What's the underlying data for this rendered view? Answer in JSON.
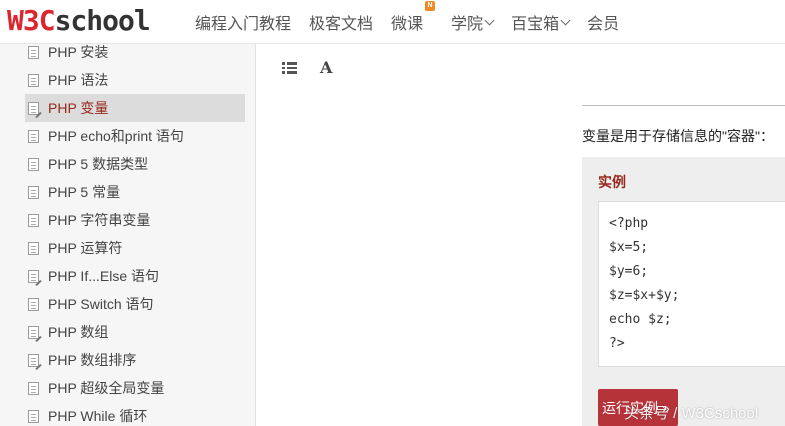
{
  "logo": {
    "prefix": "W3C",
    "suffix": "school"
  },
  "nav": {
    "items": [
      {
        "label": "编程入门教程"
      },
      {
        "label": "极客文档"
      },
      {
        "label": "微课",
        "badge": "N"
      },
      {
        "label": "学院"
      },
      {
        "label": "百宝箱"
      },
      {
        "label": "会员"
      }
    ]
  },
  "sidebar": {
    "items": [
      {
        "label": "PHP 安装"
      },
      {
        "label": "PHP 语法"
      },
      {
        "label": "PHP 变量"
      },
      {
        "label": "PHP echo和print 语句"
      },
      {
        "label": "PHP 5 数据类型"
      },
      {
        "label": "PHP 5 常量"
      },
      {
        "label": "PHP 字符串变量"
      },
      {
        "label": "PHP 运算符"
      },
      {
        "label": "PHP If...Else 语句"
      },
      {
        "label": "PHP Switch 语句"
      },
      {
        "label": "PHP 数组"
      },
      {
        "label": "PHP 数组排序"
      },
      {
        "label": "PHP 超级全局变量"
      },
      {
        "label": "PHP While 循环"
      }
    ]
  },
  "toolbar": {
    "font_icon_label": "A"
  },
  "main": {
    "intro": "变量是用于存储信息的\"容器\"：",
    "example": {
      "title": "实例",
      "code": [
        "<?php",
        "$x=5;",
        "$y=6;",
        "$z=$x+$y;",
        "echo $z;",
        "?>"
      ],
      "run_label": "运行实例 »"
    }
  },
  "watermark": "头条号 / W3Cschool",
  "colors": {
    "brand_red": "#d9262f",
    "active_text": "#96281b",
    "run_button": "#b6333a"
  }
}
